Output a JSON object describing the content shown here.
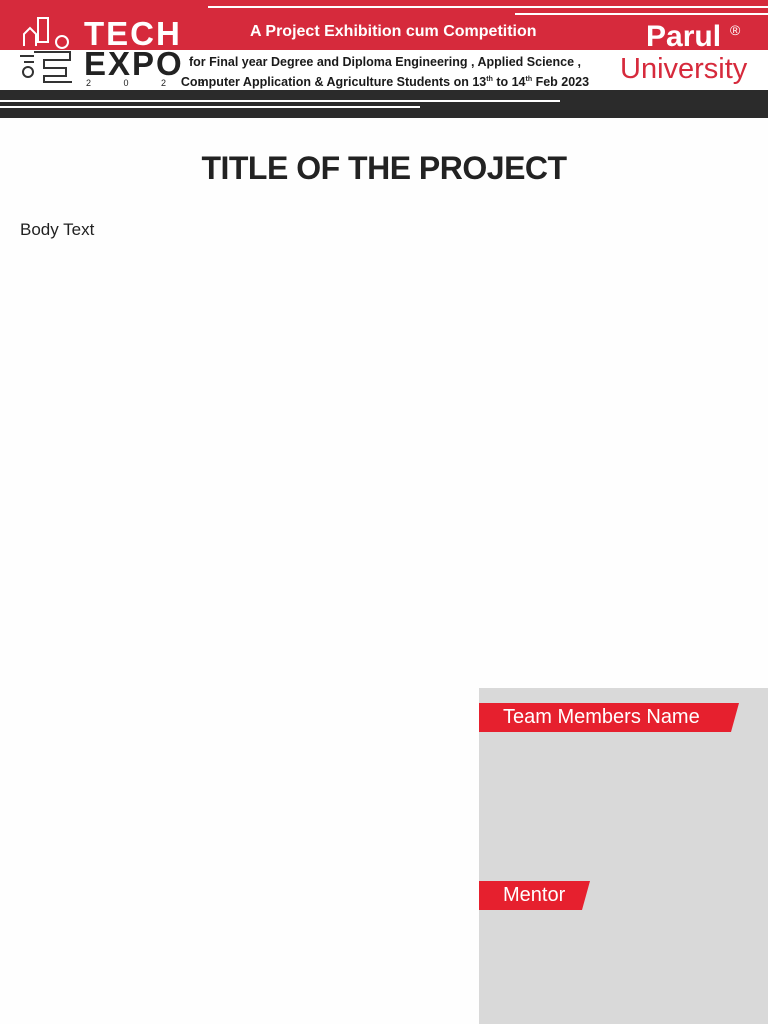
{
  "header": {
    "logo": {
      "tech": "TECH",
      "expo": "EXPO",
      "year": "2 0 2 3"
    },
    "tagline": "A Project Exhibition cum Competition",
    "description_line1": "for Final year Degree and Diploma Engineering , Applied Science ,",
    "description_line2_a": "Computer Application & Agriculture Students on 13",
    "description_line2_sup1": "th",
    "description_line2_b": " to 14",
    "description_line2_sup2": "th",
    "description_line2_c": " Feb 2023",
    "university_name": "Parul",
    "university_reg": "®",
    "university_word": "University"
  },
  "main": {
    "title": "TITLE OF THE PROJECT",
    "body": "Body Text"
  },
  "panel": {
    "team_label": "Team Members Name",
    "mentor_label": "Mentor"
  },
  "colors": {
    "brand_red": "#d62a3c",
    "tag_red": "#e6202e",
    "dark_band": "#2b2b2b",
    "panel_gray": "#d9d9d9"
  }
}
